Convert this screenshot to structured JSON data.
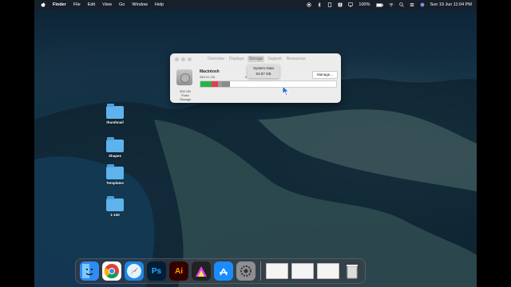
{
  "menubar": {
    "app_name": "Finder",
    "menus": [
      "File",
      "Edit",
      "View",
      "Go",
      "Window",
      "Help"
    ],
    "battery": "100%",
    "datetime": "Sun 19 Jun  11:04 PM"
  },
  "desktop_folders": [
    {
      "label": "thumbnail"
    },
    {
      "label": "Shapes"
    },
    {
      "label": "Templates"
    },
    {
      "label": "1-100"
    }
  ],
  "about_window": {
    "tabs": [
      "Overview",
      "Displays",
      "Storage",
      "Support",
      "Resources"
    ],
    "active_tab": "Storage",
    "volume_name": "Macintosh",
    "available_prefix": "385.91 GB",
    "available_suffix": "0 GB",
    "capacity": "500 GB",
    "storage_type": "Flash Storage",
    "manage_label": "Manage...",
    "tooltip_title": "System Data",
    "tooltip_value": "53.97 GB",
    "bar_segments": [
      {
        "color": "#27b34a",
        "fraction": 0.08
      },
      {
        "color": "#e83b4e",
        "fraction": 0.05
      },
      {
        "color": "#9a9a9a",
        "fraction": 0.03
      },
      {
        "color": "#8b8b8b",
        "fraction": 0.06
      }
    ]
  },
  "dock": {
    "apps": [
      {
        "name": "Finder",
        "icon": "finder-icon",
        "color": "#2f8cf0"
      },
      {
        "name": "Chrome",
        "icon": "chrome-icon",
        "color": "#ffffff"
      },
      {
        "name": "Safari",
        "icon": "safari-icon",
        "color": "#1e88e5"
      },
      {
        "name": "Photoshop",
        "icon": "photoshop-icon",
        "color": "#001e36",
        "glyph": "Ps"
      },
      {
        "name": "Illustrator",
        "icon": "illustrator-icon",
        "color": "#330000",
        "glyph": "Ai"
      },
      {
        "name": "Final Cut Pro",
        "icon": "final-cut-icon",
        "color": "#222222"
      },
      {
        "name": "App Store",
        "icon": "app-store-icon",
        "color": "#1a8cff"
      },
      {
        "name": "System Preferences",
        "icon": "settings-icon",
        "color": "#8e8e93"
      }
    ]
  }
}
